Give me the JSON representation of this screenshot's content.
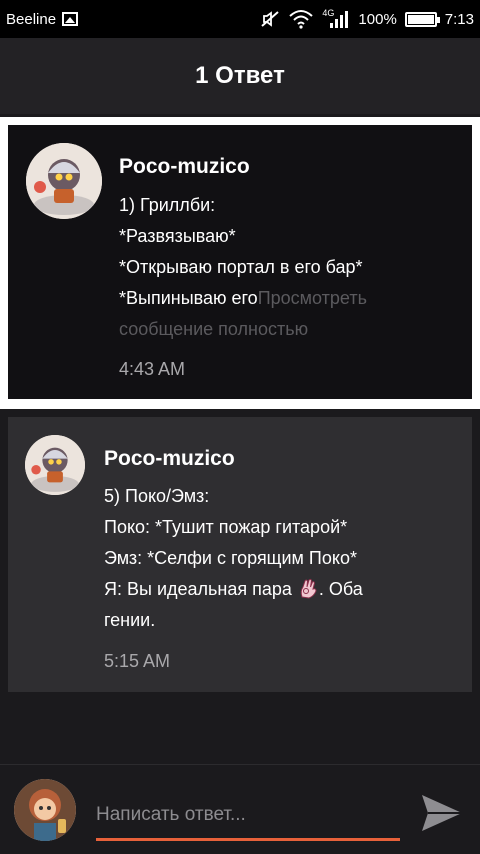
{
  "status_bar": {
    "carrier": "Beeline",
    "network": "4G",
    "battery": "100%",
    "time": "7:13"
  },
  "header": {
    "title": "1 Ответ"
  },
  "replies": [
    {
      "author": "Poco-muzico",
      "lines": [
        "1) Гриллби:",
        "*Развязываю*",
        "*Открываю портал в его бар*"
      ],
      "last_line": "*Выпинываю его",
      "more_link": "Просмотреть",
      "more_link_2": "сообщение полностью",
      "time": "4:43 AM"
    },
    {
      "author": "Poco-muzico",
      "lines": [
        "5) Поко/Эмз:",
        "Поко: *Тушит пожар гитарой*",
        "Эмз: *Селфи с горящим Поко*"
      ],
      "line4": "Я: Вы идеальная пара",
      "line4_end": ". Оба",
      "line5": "гении.",
      "time": "5:15 AM"
    }
  ],
  "composer": {
    "placeholder": "Написать ответ..."
  },
  "colors": {
    "accent": "#e8613a",
    "background": "#1b1a1d",
    "header": "#232225",
    "highlight_card": "#111013",
    "card": "#2f2e31"
  }
}
